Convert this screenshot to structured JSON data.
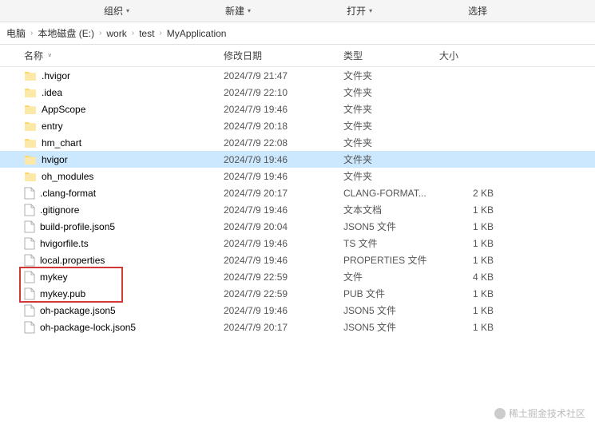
{
  "toolbar": {
    "organize": "组织",
    "new": "新建",
    "open": "打开",
    "select": "选择"
  },
  "breadcrumb": {
    "items": [
      "电脑",
      "本地磁盘 (E:)",
      "work",
      "test",
      "MyApplication"
    ]
  },
  "columns": {
    "name": "名称",
    "date": "修改日期",
    "type": "类型",
    "size": "大小"
  },
  "files": [
    {
      "name": ".hvigor",
      "date": "2024/7/9 21:47",
      "type": "文件夹",
      "size": "",
      "kind": "folder"
    },
    {
      "name": ".idea",
      "date": "2024/7/9 22:10",
      "type": "文件夹",
      "size": "",
      "kind": "folder"
    },
    {
      "name": "AppScope",
      "date": "2024/7/9 19:46",
      "type": "文件夹",
      "size": "",
      "kind": "folder"
    },
    {
      "name": "entry",
      "date": "2024/7/9 20:18",
      "type": "文件夹",
      "size": "",
      "kind": "folder"
    },
    {
      "name": "hm_chart",
      "date": "2024/7/9 22:08",
      "type": "文件夹",
      "size": "",
      "kind": "folder"
    },
    {
      "name": "hvigor",
      "date": "2024/7/9 19:46",
      "type": "文件夹",
      "size": "",
      "kind": "folder",
      "selected": true
    },
    {
      "name": "oh_modules",
      "date": "2024/7/9 19:46",
      "type": "文件夹",
      "size": "",
      "kind": "folder"
    },
    {
      "name": ".clang-format",
      "date": "2024/7/9 20:17",
      "type": "CLANG-FORMAT...",
      "size": "2 KB",
      "kind": "file"
    },
    {
      "name": ".gitignore",
      "date": "2024/7/9 19:46",
      "type": "文本文档",
      "size": "1 KB",
      "kind": "file"
    },
    {
      "name": "build-profile.json5",
      "date": "2024/7/9 20:04",
      "type": "JSON5 文件",
      "size": "1 KB",
      "kind": "file"
    },
    {
      "name": "hvigorfile.ts",
      "date": "2024/7/9 19:46",
      "type": "TS 文件",
      "size": "1 KB",
      "kind": "file"
    },
    {
      "name": "local.properties",
      "date": "2024/7/9 19:46",
      "type": "PROPERTIES 文件",
      "size": "1 KB",
      "kind": "file"
    },
    {
      "name": "mykey",
      "date": "2024/7/9 22:59",
      "type": "文件",
      "size": "4 KB",
      "kind": "file",
      "highlight": true
    },
    {
      "name": "mykey.pub",
      "date": "2024/7/9 22:59",
      "type": "PUB 文件",
      "size": "1 KB",
      "kind": "file",
      "highlight": true
    },
    {
      "name": "oh-package.json5",
      "date": "2024/7/9 19:46",
      "type": "JSON5 文件",
      "size": "1 KB",
      "kind": "file"
    },
    {
      "name": "oh-package-lock.json5",
      "date": "2024/7/9 20:17",
      "type": "JSON5 文件",
      "size": "1 KB",
      "kind": "file"
    }
  ],
  "watermark": "稀土掘金技术社区"
}
